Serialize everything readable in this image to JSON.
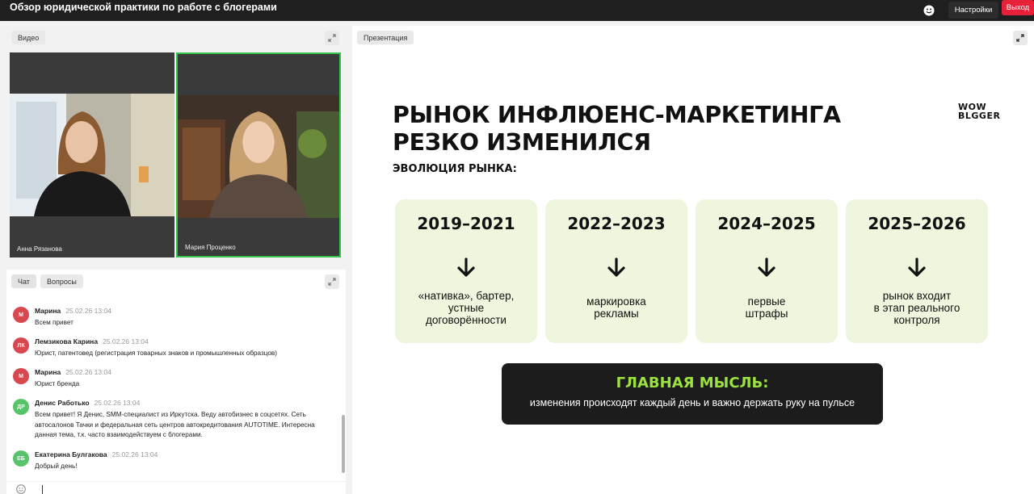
{
  "header": {
    "title": "Обзор юридической практики по работе с блогерами",
    "settings_label": "Настройки",
    "exit_label": "Выход",
    "accent_color": "#e8213a"
  },
  "video": {
    "tab_label": "Видео",
    "participants": [
      {
        "name": "Анна Рязанова",
        "speaking": false
      },
      {
        "name": "Мария Проценко",
        "speaking": true
      }
    ]
  },
  "chat": {
    "tabs": [
      {
        "label": "Чат",
        "active": true
      },
      {
        "label": "Вопросы",
        "active": false
      }
    ],
    "messages": [
      {
        "author": "Марина",
        "initials": "М",
        "avatar_color": "#d9474f",
        "time": "25.02.26 13:04",
        "text": "Всем привет"
      },
      {
        "author": "Лемзикова Карина",
        "initials": "ЛК",
        "avatar_color": "#d9474f",
        "time": "25.02.26 13:04",
        "text": "Юрист, патентовед (регистрация товарных знаков и промышленных образцов)"
      },
      {
        "author": "Марина",
        "initials": "М",
        "avatar_color": "#d9474f",
        "time": "25.02.26 13:04",
        "text": "Юрист бренда"
      },
      {
        "author": "Денис Работько",
        "initials": "ДР",
        "avatar_color": "#57c46c",
        "time": "25.02.26 13:04",
        "text": "Всем привет! Я Денис, SMM-специалист из Иркутска. Веду автобизнес в соцсетях. Сеть автосалонов Тачки и федеральная сеть центров автокредитования AUTOTIME. Интересна данная тема, т.к. часто взаимодействуем с блогерами."
      },
      {
        "author": "Екатерина Булгакова",
        "initials": "ЕБ",
        "avatar_color": "#57c46c",
        "time": "25.02.26 13:04",
        "text": "Добрый день!"
      }
    ]
  },
  "presentation": {
    "tab_label": "Презентация",
    "slide": {
      "title_line1": "РЫНОК ИНФЛЮЕНС-МАРКЕТИНГА",
      "title_line2": "РЕЗКО ИЗМЕНИЛСЯ",
      "subtitle": "ЭВОЛЮЦИЯ РЫНКА:",
      "logo_lines": [
        "WOW",
        "BLGGER"
      ],
      "cards": [
        {
          "years": "2019–2021",
          "text": "«нативка», бартер,\nустные\nдоговорённости"
        },
        {
          "years": "2022–2023",
          "text": "маркировка\nрекламы"
        },
        {
          "years": "2024–2025",
          "text": "первые\nштрафы"
        },
        {
          "years": "2025–2026",
          "text": "рынок входит\nв этап реального\nконтроля"
        }
      ],
      "main_idea_title": "ГЛАВНАЯ МЫСЛЬ:",
      "main_idea_text": "изменения происходят каждый день и важно держать руку на пульсе",
      "card_color": "#eef6dd",
      "highlight_color": "#9be13f"
    }
  }
}
